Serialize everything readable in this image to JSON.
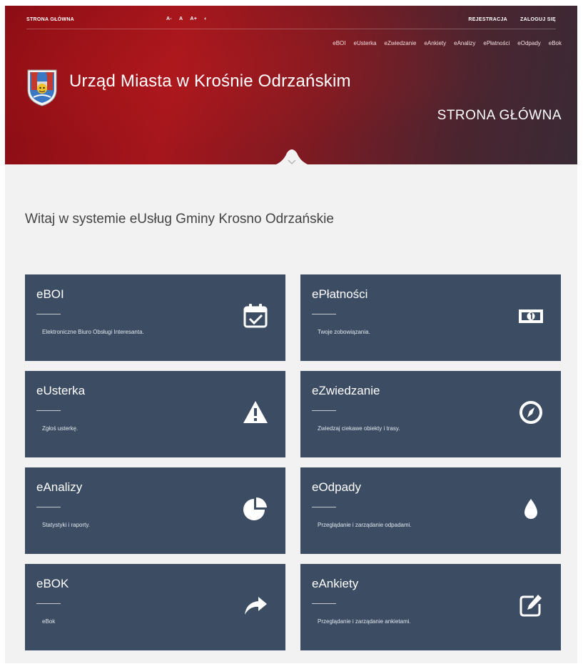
{
  "topbar": {
    "home": "STRONA GŁÓWNA",
    "font_small": "A-",
    "font_normal": "A",
    "font_large": "A+",
    "contrast": "◐",
    "register": "REJESTRACJA",
    "login": "ZALOGUJ SIĘ"
  },
  "nav": [
    "eBOI",
    "eUsterka",
    "eZwiedzanie",
    "eAnkiety",
    "eAnalizy",
    "ePłatności",
    "eOdpady",
    "eBok"
  ],
  "header": {
    "title": "Urząd Miasta w Krośnie Odrzańskim",
    "page_heading": "STRONA GŁÓWNA"
  },
  "welcome": "Witaj w systemie eUsług Gminy Krosno Odrzańskie",
  "tiles": [
    {
      "title": "eBOI",
      "desc": "Elektroniczne Biuro Obsługi Interesanta.",
      "icon": "calendar-check-icon"
    },
    {
      "title": "ePłatności",
      "desc": "Twoje zobowiązania.",
      "icon": "money-icon"
    },
    {
      "title": "eUsterka",
      "desc": "Zgłoś usterkę.",
      "icon": "warning-icon"
    },
    {
      "title": "eZwiedzanie",
      "desc": "Zwiedzaj ciekawe obiekty i trasy.",
      "icon": "compass-icon"
    },
    {
      "title": "eAnalizy",
      "desc": "Statystyki i raporty.",
      "icon": "pie-chart-icon"
    },
    {
      "title": "eOdpady",
      "desc": "Przeglądanie i zarządanie odpadami.",
      "icon": "drop-icon"
    },
    {
      "title": "eBOK",
      "desc": "eBok",
      "icon": "share-arrow-icon"
    },
    {
      "title": "eAnkiety",
      "desc": "Przeglądanie i zarządanie ankietami.",
      "icon": "edit-icon"
    }
  ],
  "colors": {
    "header_red": "#a5161c",
    "header_dark": "#3a2a35",
    "tile_bg": "#3c4c62",
    "page_bg": "#f2f2f2"
  }
}
